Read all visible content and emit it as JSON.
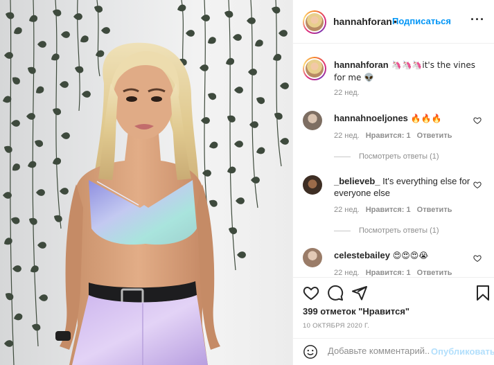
{
  "header": {
    "username": "hannahforan",
    "separator": "•",
    "follow_label": "Подписаться",
    "more_label": "···"
  },
  "caption": {
    "username": "hannahforan",
    "text": " 🦄🦄🦄it's the vines for me 👽",
    "time": "22 нед."
  },
  "comments": [
    {
      "username": "hannahnoeljones",
      "text": " 🔥🔥🔥",
      "time": "22 нед.",
      "likes": "Нравится: 1",
      "reply": "Ответить",
      "replies": "Посмотреть ответы (1)",
      "avatar_color": "#9a8b7d"
    },
    {
      "username": "_believeb_",
      "text": " It's everything else for everyone else",
      "time": "22 нед.",
      "likes": "Нравится: 1",
      "reply": "Ответить",
      "replies": "Посмотреть ответы (1)",
      "avatar_color": "#6b4a32"
    },
    {
      "username": "celestebailey",
      "text": " 😍😍😍😭",
      "time": "22 нед.",
      "likes": "Нравится: 1",
      "reply": "Ответить",
      "avatar_color": "#b99a86"
    }
  ],
  "actions": {
    "icons": [
      "heart-icon",
      "comment-icon",
      "share-icon",
      "bookmark-icon"
    ],
    "likes_text": "399 отметок \"Нравится\"",
    "date": "10 ОКТЯБРЯ 2020 Г."
  },
  "add_comment": {
    "placeholder": "Добавьте комментарий...",
    "publish_label": "Опубликовать"
  },
  "colors": {
    "accent": "#0095f6",
    "publish_disabled": "#b2dffc",
    "muted": "#8e8e8e",
    "text": "#262626",
    "border": "#efefef"
  }
}
